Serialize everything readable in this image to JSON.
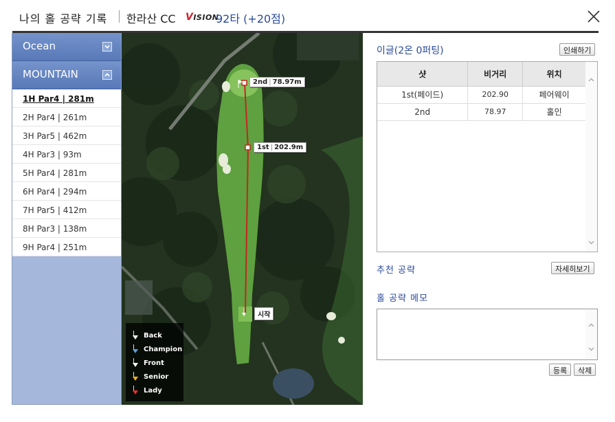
{
  "header": {
    "title": "나의 홀 공략 기록",
    "course_name": "한라산 CC",
    "brand_v": "V",
    "brand_rest": "ISION",
    "score": "92타 (+20점)"
  },
  "sidebar": {
    "groups": [
      {
        "label": "Ocean",
        "expanded": false
      },
      {
        "label": "MOUNTAIN",
        "expanded": true
      }
    ],
    "holes": [
      {
        "hole": "1H Par4",
        "dist": "281m",
        "active": true
      },
      {
        "hole": "2H Par4",
        "dist": "261m"
      },
      {
        "hole": "3H Par5",
        "dist": "462m"
      },
      {
        "hole": "4H Par3",
        "dist": "93m"
      },
      {
        "hole": "5H Par4",
        "dist": "281m"
      },
      {
        "hole": "6H Par4",
        "dist": "294m"
      },
      {
        "hole": "7H Par5",
        "dist": "412m"
      },
      {
        "hole": "8H Par3",
        "dist": "138m"
      },
      {
        "hole": "9H Par4",
        "dist": "251m"
      }
    ]
  },
  "map": {
    "start_label": "시작",
    "shot1": {
      "num": "1st",
      "dist": "202.9m"
    },
    "shot2": {
      "num": "2nd",
      "dist": "78.97m"
    },
    "legend": [
      {
        "label": "Back",
        "color": "#ffffff"
      },
      {
        "label": "Champion",
        "color": "#5aa0e0"
      },
      {
        "label": "Front",
        "color": "#ffffff"
      },
      {
        "label": "Senior",
        "color": "#f0b020"
      },
      {
        "label": "Lady",
        "color": "#e03030"
      }
    ]
  },
  "panel": {
    "result": "이글(2온 0퍼팅)",
    "print_button": "인쇄하기",
    "table": {
      "headers": [
        "샷",
        "비거리",
        "위치"
      ],
      "rows": [
        [
          "1st(페이드)",
          "202.90",
          "페어웨이"
        ],
        [
          "2nd",
          "78.97",
          "홀인"
        ]
      ]
    },
    "recommend_label": "추천 공략",
    "detail_button": "자세히보기",
    "memo_label": "홀 공략 메모",
    "memo_value": "",
    "register_button": "등록",
    "delete_button": "삭제"
  },
  "colors": {
    "accent": "#2a4a9b",
    "group_header": "#6584c2",
    "sidebar_bg": "#a5b8dc",
    "shot_line": "#c0281e"
  }
}
